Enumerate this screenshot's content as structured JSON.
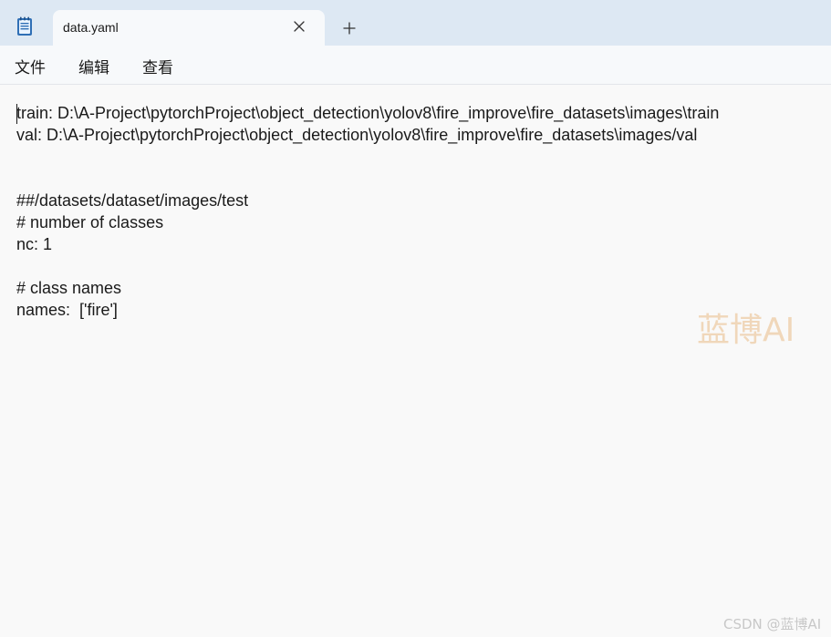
{
  "tab": {
    "title": "data.yaml"
  },
  "icons": {
    "app": "notepad-icon",
    "close": "close-icon",
    "new_tab": "plus-icon"
  },
  "menu": [
    {
      "label": "文件"
    },
    {
      "label": "编辑"
    },
    {
      "label": "查看"
    }
  ],
  "editor": {
    "lines": [
      "train: D:\\A-Project\\pytorchProject\\object_detection\\yolov8\\fire_improve\\fire_datasets\\images\\train",
      "val: D:\\A-Project\\pytorchProject\\object_detection\\yolov8\\fire_improve\\fire_datasets\\images/val",
      "",
      "",
      "##/datasets/dataset/images/test",
      "# number of classes",
      "nc: 1",
      "",
      "# class names",
      "names:  ['fire']"
    ]
  },
  "watermark": "蓝博AI",
  "credit": "CSDN @蓝博AI",
  "colors": {
    "titlebar": "#dde8f3",
    "tab_bg": "#f7f9fb",
    "editor_bg": "#f9f9f9",
    "text": "#1a1a1a"
  }
}
